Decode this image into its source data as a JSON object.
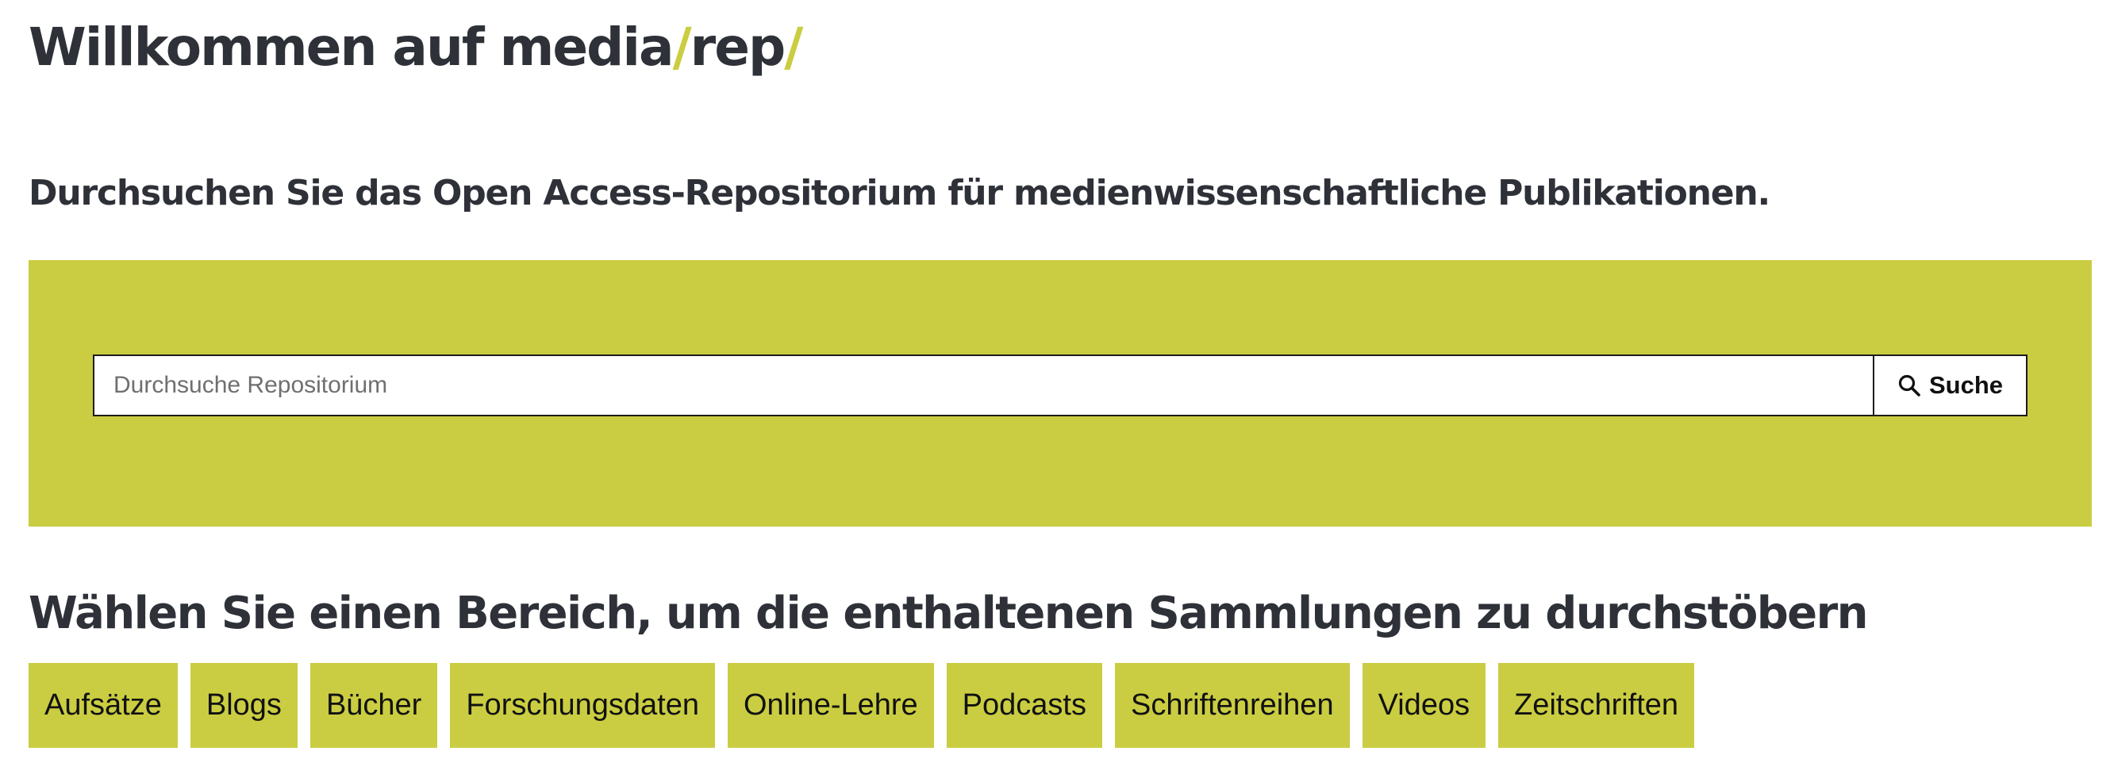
{
  "header": {
    "title_prefix": "Willkommen auf media",
    "slash_1": "/",
    "title_mid": "rep",
    "slash_2": "/",
    "subtitle": "Durchsuchen Sie das Open Access-Repositorium für medienwissenschaftliche Publikationen."
  },
  "search": {
    "placeholder": "Durchsuche Repositorium",
    "value": "",
    "button_label": "Suche",
    "button_icon": "search-icon",
    "panel_color": "#cacd41"
  },
  "browse": {
    "heading": "Wählen Sie einen Bereich, um die enthaltenen Sammlungen zu durchstöbern",
    "categories": [
      "Aufsätze",
      "Blogs",
      "Bücher",
      "Forschungsdaten",
      "Online-Lehre",
      "Podcasts",
      "Schriftenreihen",
      "Videos",
      "Zeitschriften"
    ]
  },
  "colors": {
    "accent": "#cacd41",
    "text": "#2e3138"
  }
}
